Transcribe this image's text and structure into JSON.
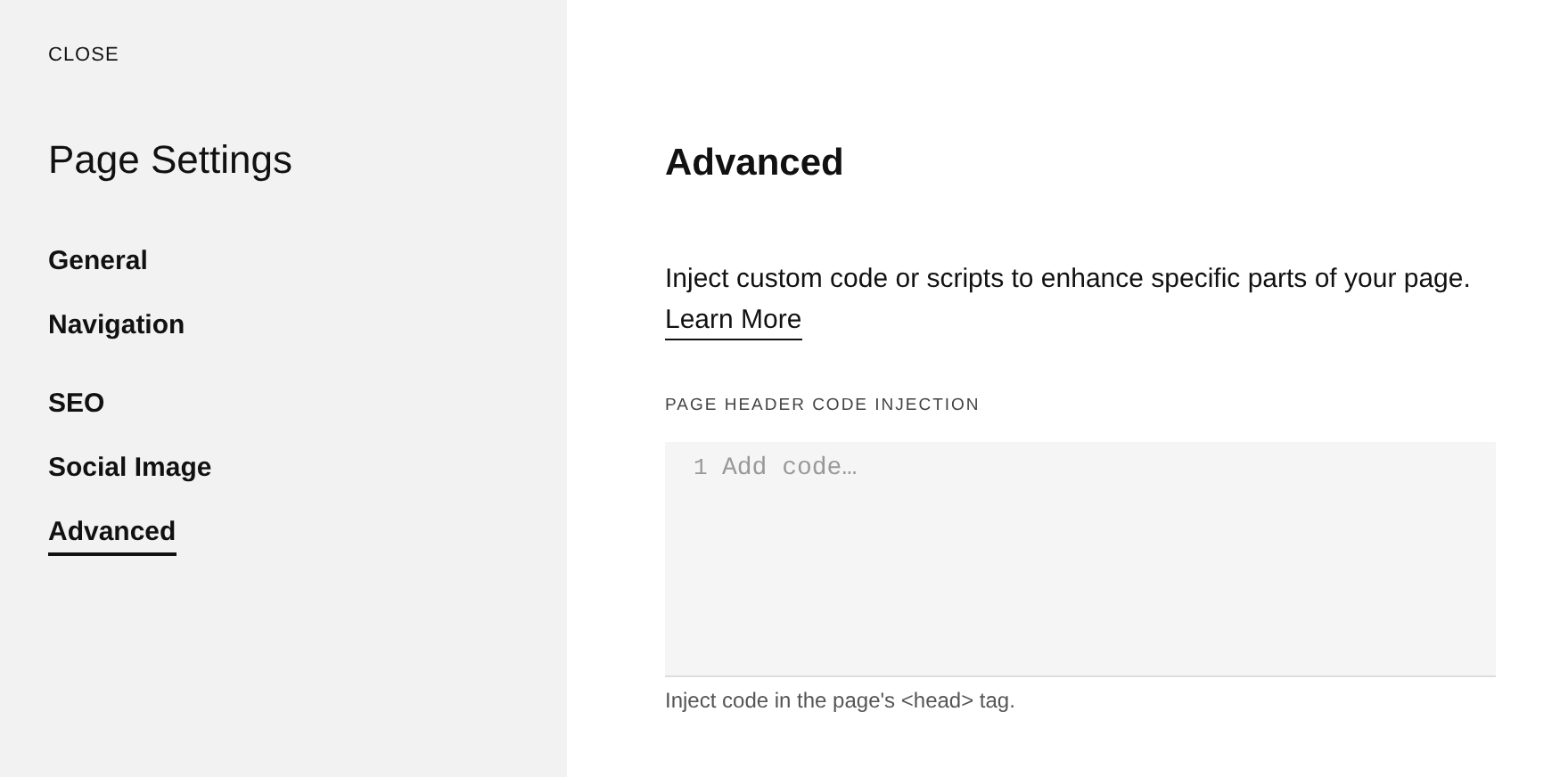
{
  "sidebar": {
    "close": "CLOSE",
    "title": "Page Settings",
    "nav_groups": [
      [
        {
          "label": "General",
          "selected": false
        },
        {
          "label": "Navigation",
          "selected": false
        }
      ],
      [
        {
          "label": "SEO",
          "selected": false
        },
        {
          "label": "Social Image",
          "selected": false
        },
        {
          "label": "Advanced",
          "selected": true
        }
      ]
    ]
  },
  "main": {
    "heading": "Advanced",
    "description": "Inject custom code or scripts to enhance specific parts of your page.",
    "link": "Learn More",
    "field_label": "PAGE HEADER CODE INJECTION",
    "line_number": "1",
    "placeholder": "Add code…",
    "hint": "Inject code in the page's <head> tag."
  }
}
